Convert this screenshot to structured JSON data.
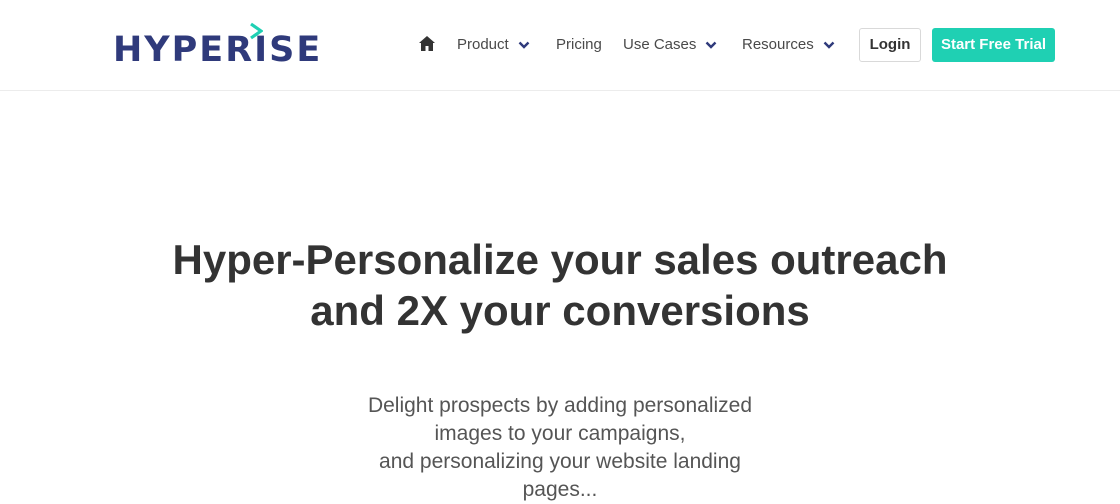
{
  "brand": {
    "name": "HYPERISE",
    "logo_icon": "chevron-right-mark",
    "logo_color": "#2f3a7b",
    "accent_color": "#1fd0b3"
  },
  "nav": {
    "home_icon": "home-icon",
    "items": [
      {
        "label": "Product",
        "has_dropdown": true
      },
      {
        "label": "Pricing",
        "has_dropdown": false
      },
      {
        "label": "Use Cases",
        "has_dropdown": true
      },
      {
        "label": "Resources",
        "has_dropdown": true
      }
    ],
    "login_label": "Login",
    "cta_label": "Start Free Trial"
  },
  "hero": {
    "title_line1": "Hyper-Personalize your sales outreach",
    "title_line2": "and 2X your conversions",
    "subtitle_lines": [
      "Delight prospects by adding personalized",
      "images to your campaigns,",
      "and personalizing your website landing",
      "pages..."
    ]
  }
}
